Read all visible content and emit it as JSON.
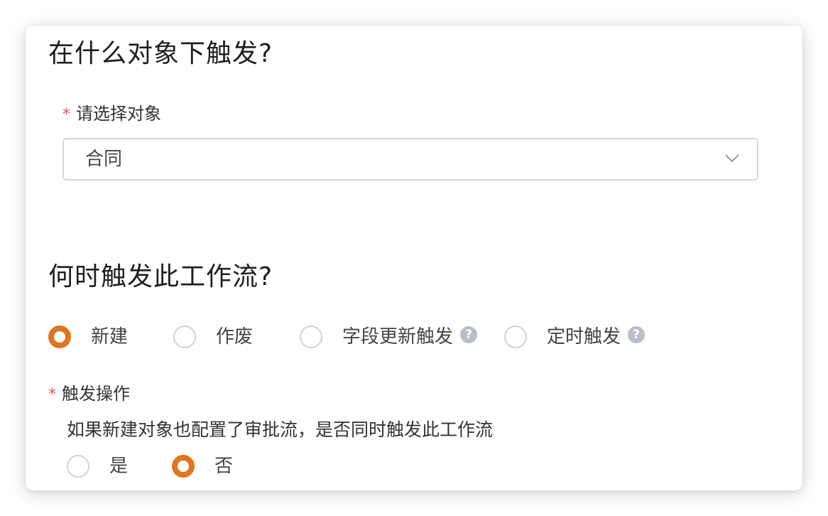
{
  "section1": {
    "title": "在什么对象下触发?",
    "field_label": "请选择对象",
    "required_mark": "*",
    "select_value": "合同"
  },
  "section2": {
    "title": "何时触发此工作流?",
    "trigger_options": [
      {
        "label": "新建",
        "checked": true,
        "help": false
      },
      {
        "label": "作废",
        "checked": false,
        "help": false
      },
      {
        "label": "字段更新触发",
        "checked": false,
        "help": true
      },
      {
        "label": "定时触发",
        "checked": false,
        "help": true
      }
    ],
    "help_glyph": "?"
  },
  "action": {
    "required_mark": "*",
    "label": "触发操作",
    "question": "如果新建对象也配置了审批流，是否同时触发此工作流",
    "options": [
      {
        "label": "是",
        "checked": false
      },
      {
        "label": "否",
        "checked": true
      }
    ]
  },
  "colors": {
    "accent": "#e07520",
    "required": "#e0594a",
    "help_bg": "#b9bec8"
  },
  "icons": {
    "select_caret": "chevron-down-icon",
    "help": "question-circle-icon"
  }
}
